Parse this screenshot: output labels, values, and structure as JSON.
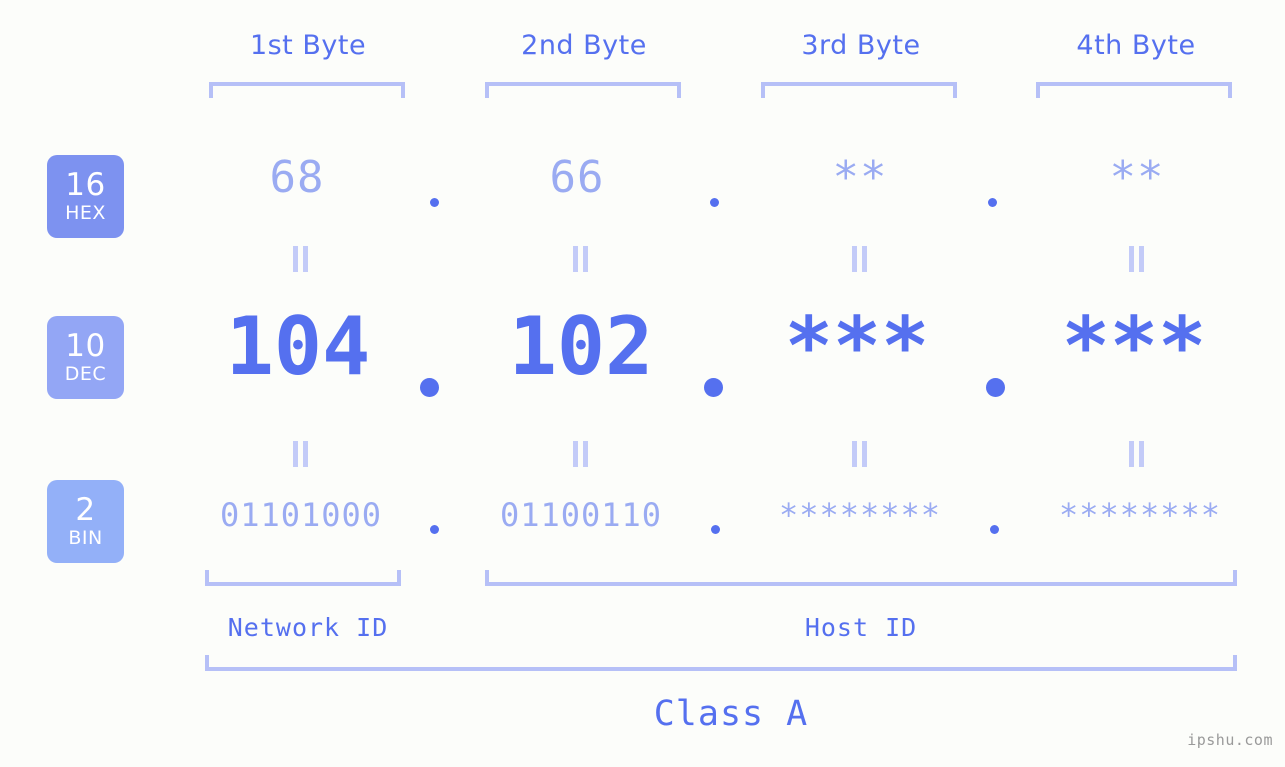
{
  "header": {
    "byte_labels": [
      {
        "label": "1st Byte"
      },
      {
        "label": "2nd Byte"
      },
      {
        "label": "3rd Byte"
      },
      {
        "label": "4th Byte"
      }
    ]
  },
  "rows": [
    {
      "badge_number": "16",
      "badge_abbr": "HEX",
      "values": [
        "68",
        "66",
        "**",
        "**"
      ]
    },
    {
      "badge_number": "10",
      "badge_abbr": "DEC",
      "values": [
        "104",
        "102",
        "***",
        "***"
      ]
    },
    {
      "badge_number": "2",
      "badge_abbr": "BIN",
      "values": [
        "01101000",
        "01100110",
        "********",
        "********"
      ]
    }
  ],
  "separators": {
    "dot": "."
  },
  "footer": {
    "network_id_label": "Network ID",
    "host_id_label": "Host ID",
    "class_label": "Class A"
  },
  "watermark": "ipshu.com",
  "colors": {
    "background": "#fcfdfa",
    "accent_strong": "#5570ef",
    "accent_mid": "#9aabf2",
    "accent_light": "#b6c0f7",
    "badge_hex": "#7d92f0",
    "badge_dec": "#93a6f5",
    "badge_bin": "#93b0f8",
    "watermark_gray": "#9a9a9a"
  }
}
